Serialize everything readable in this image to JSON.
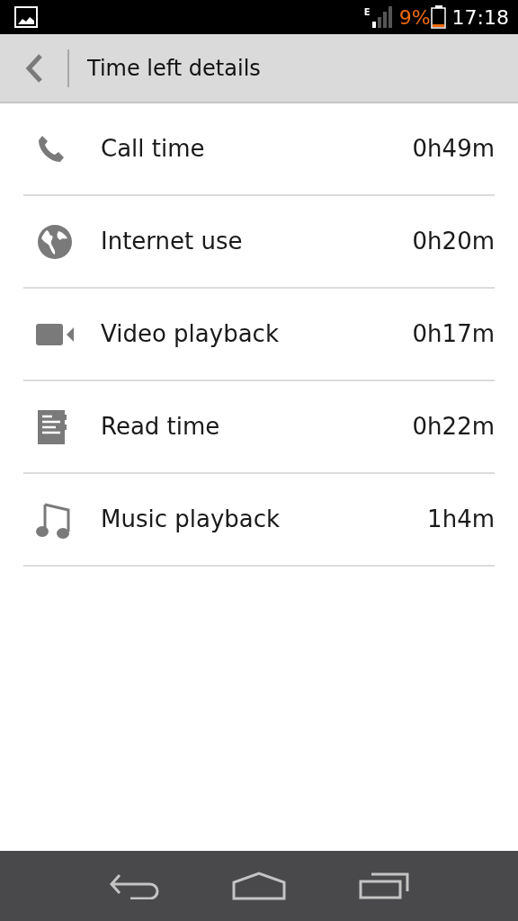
{
  "status_bar": {
    "network": "E",
    "battery": "9%",
    "time": "17:18"
  },
  "header": {
    "title": "Time left details"
  },
  "items": [
    {
      "kind": "call",
      "label": "Call time",
      "value": "0h49m"
    },
    {
      "kind": "internet",
      "label": "Internet use",
      "value": "0h20m"
    },
    {
      "kind": "video",
      "label": "Video playback",
      "value": "0h17m"
    },
    {
      "kind": "read",
      "label": "Read time",
      "value": "0h22m"
    },
    {
      "kind": "music",
      "label": "Music playback",
      "value": "1h4m"
    }
  ]
}
